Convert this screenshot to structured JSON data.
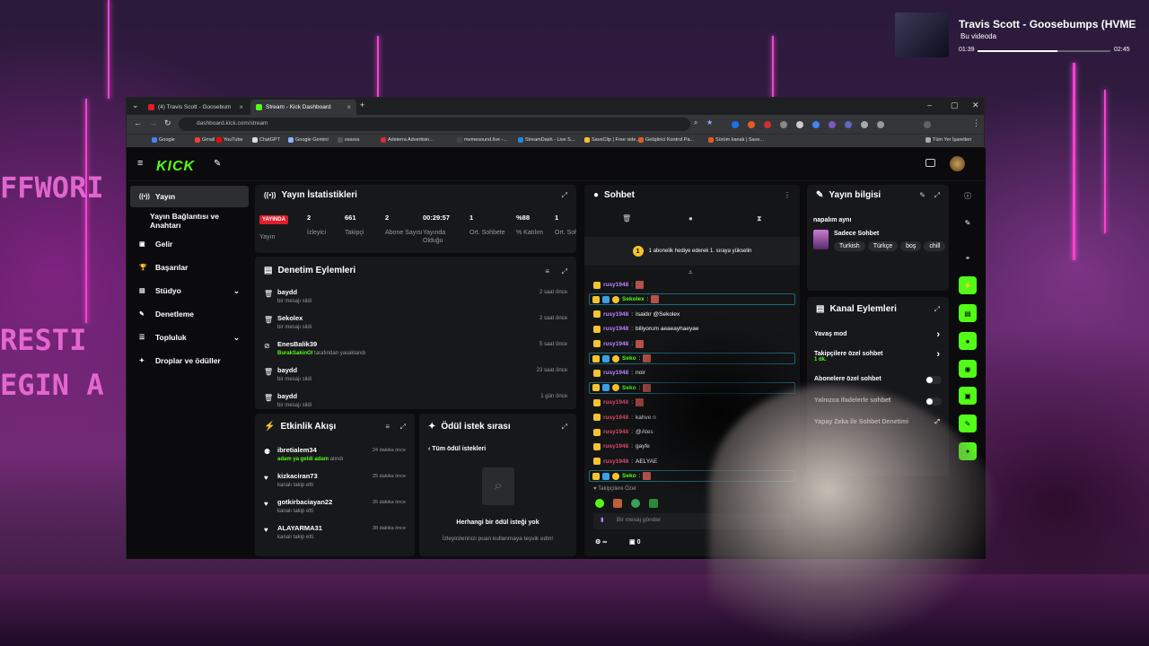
{
  "media": {
    "title": "Travis Scott - Goosebumps (HVME",
    "subtitle": "Bu videoda",
    "elapsed": "01:39",
    "duration": "02:45",
    "progress": 0.6
  },
  "backdrop": {
    "left_text": "FFWORI",
    "left_text2": "RESTI",
    "left_text3": "EGIN A"
  },
  "browser": {
    "tabs": [
      {
        "label": "(4) Travis Scott - Goosebum"
      },
      {
        "label": "Stream - Kick Dashboard"
      }
    ],
    "url": "dashboard.kick.com/stream",
    "bookmarks": [
      "Google",
      "Gmail",
      "YouTube",
      "ChatGPT",
      "Google Gemini",
      "ssssss",
      "Adsterra Advertisin...",
      "memesound.live -...",
      "StreamDash - Live S...",
      "SaveClip | Free vide...",
      "Geliştirici Kontrol Pa...",
      "Sürüm kanalı | Save..."
    ],
    "all_bookmarks": "Tüm Yer İşaretleri"
  },
  "kick": {
    "logo": "KICK",
    "sidebar": [
      {
        "label": "Yayın",
        "icon": "broadcast-icon"
      },
      {
        "label": "Yayın Bağlantısı ve Anahtarı",
        "icon": ""
      },
      {
        "label": "Gelir",
        "icon": "dollar-icon"
      },
      {
        "label": "Başarılar",
        "icon": "trophy-icon"
      },
      {
        "label": "Stüdyo",
        "icon": "studio-icon"
      },
      {
        "label": "Denetleme",
        "icon": "wrench-icon"
      },
      {
        "label": "Topluluk",
        "icon": "community-icon"
      },
      {
        "label": "Droplar ve ödüller",
        "icon": "gift-icon"
      }
    ],
    "stats": {
      "title": "Yayın İstatistikleri",
      "live_label": "YAYINDA",
      "live_sub": "Yayın",
      "items": [
        {
          "value": "2",
          "label": "İzleyici"
        },
        {
          "value": "661",
          "label": "Takipçi"
        },
        {
          "value": "2",
          "label": "Abone Sayısı"
        },
        {
          "value": "00:29:57",
          "label": "Yayında Olduğu"
        },
        {
          "value": "1",
          "label": "Ort. Sohbete"
        },
        {
          "value": "%88",
          "label": "% Katılım"
        },
        {
          "value": "1",
          "label": "Ort. Sohbete"
        }
      ]
    },
    "moderation": {
      "title": "Denetim Eylemleri",
      "rows": [
        {
          "name": "baydd",
          "desc": "bir mesajı sildi",
          "time": "2 saat önce"
        },
        {
          "name": "Sekolex",
          "desc": "bir mesajı sildi",
          "time": "2 saat önce"
        },
        {
          "name": "EnesBalik39",
          "desc_highlight": "BurakSakinOl",
          "desc": "tarafından yasaklandı",
          "time": "5 saat önce"
        },
        {
          "name": "baydd",
          "desc": "bir mesajı sildi",
          "time": "23 saat önce"
        },
        {
          "name": "baydd",
          "desc": "bir mesajı sildi",
          "time": "1 gün önce"
        }
      ]
    },
    "activity": {
      "title": "Etkinlik Akışı",
      "rows": [
        {
          "name": "ibretialem34",
          "desc_highlight": "adam ya geldi adam",
          "desc": "alındı",
          "time": "24 dakika önce"
        },
        {
          "name": "kizkaciran73",
          "desc": "kanalı takip etti",
          "time": "25 dakika önce"
        },
        {
          "name": "gotkirbaciayan22",
          "desc": "kanalı takip etti",
          "time": "26 dakika önce"
        },
        {
          "name": "ALAYARMA31",
          "desc": "kanalı takip etti",
          "time": "38 dakika önce"
        }
      ]
    },
    "rewards": {
      "title": "Ödül istek sırası",
      "back": "Tüm ödül istekleri",
      "empty_title": "Herhangi bir ödül isteği yok",
      "empty_sub": "İzleyicilerinizi puan kullanmaya teşvik edin!"
    },
    "chat": {
      "title": "Sohbet",
      "gift_notice": "1 abonelik hediye ederek 1. sıraya yükselin",
      "gift_rank": "1",
      "messages": [
        {
          "user": "rusy1948",
          "text": "",
          "user_color": "#b884ff"
        },
        {
          "user": "Sekolex",
          "text": "",
          "user_color": "#53fc18",
          "highlight": true
        },
        {
          "user": "rusy1948",
          "text": "Isaidır @Sekolex",
          "user_color": "#b884ff"
        },
        {
          "user": "rusy1948",
          "text": "biliyorum aeaeayhaeyae",
          "user_color": "#b884ff"
        },
        {
          "user": "rusy1948",
          "text": "",
          "user_color": "#b884ff"
        },
        {
          "user": "Seko",
          "text": "",
          "user_color": "#53fc18",
          "highlight": true
        },
        {
          "user": "rusy1948",
          "text": "noir",
          "user_color": "#b884ff"
        },
        {
          "user": "Seko",
          "text": "",
          "user_color": "#53fc18",
          "highlight": true
        },
        {
          "user": "rusy1948",
          "text": "",
          "user_color": "#e34a6b"
        },
        {
          "user": "rusy1948",
          "text": "kahve n",
          "user_color": "#e34a6b"
        },
        {
          "user": "rusy1948",
          "text": "@Ates",
          "user_color": "#e34a6b"
        },
        {
          "user": "rusy1948",
          "text": "gayfe",
          "user_color": "#e34a6b"
        },
        {
          "user": "rusy1948",
          "text": "AELYAE",
          "user_color": "#e34a6b"
        },
        {
          "user": "Seko",
          "text": "",
          "user_color": "#53fc18",
          "highlight": true
        }
      ],
      "followers_only": "Takipçilere Özel",
      "input_placeholder": "Bir mesaj gönder",
      "points": "0"
    },
    "stream_info": {
      "title": "Yayın bilgisi",
      "stream_title": "napalım aynı",
      "category": "Sadece Sohbet",
      "tags": [
        "Turkish",
        "Türkçe",
        "boş",
        "chill"
      ]
    },
    "channel_actions": {
      "title": "Kanal Eylemleri",
      "items": [
        {
          "label": "Yavaş mod",
          "type": "arrow"
        },
        {
          "label": "Takipçilere özel sohbet",
          "sub": "1 dk.",
          "type": "arrow"
        },
        {
          "label": "Abonelere özel sohbet",
          "type": "toggle"
        },
        {
          "label": "Yalnızca ifadelerle sohbet",
          "type": "toggle"
        },
        {
          "label": "Yapay Zeka ile Sohbet Denetimi",
          "type": "link"
        }
      ]
    },
    "colors": {
      "accent": "#53fc18",
      "live": "#e21c2b",
      "panel": "#17181b"
    }
  }
}
